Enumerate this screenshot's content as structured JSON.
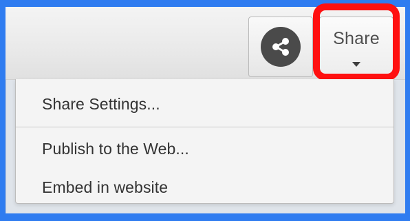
{
  "toolbar": {
    "share_button_label": "Share",
    "share_icon": "share-icon",
    "dropdown_icon": "chevron-down-icon"
  },
  "menu": {
    "items": [
      {
        "label": "Share Settings..."
      },
      {
        "label": "Publish to the Web..."
      },
      {
        "label": "Embed in website"
      }
    ]
  },
  "colors": {
    "background": "#2f7cf0",
    "highlight": "#ff1010",
    "icon_dark": "#4a4a4a"
  }
}
